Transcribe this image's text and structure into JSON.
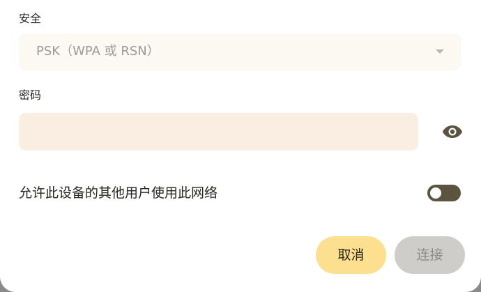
{
  "security": {
    "label": "安全",
    "selected_value": "PSK（WPA 或 RSN）",
    "icon": "chevron-down-icon"
  },
  "password": {
    "label": "密码",
    "value": "",
    "placeholder": "",
    "toggle_icon": "eye-icon"
  },
  "share": {
    "label": "允许此设备的其他用户使用此网络",
    "enabled": false
  },
  "actions": {
    "cancel_label": "取消",
    "connect_label": "连接"
  },
  "colors": {
    "accent": "#5c5440",
    "cancel_bg": "#fde08f",
    "disabled_bg": "#cfcdca",
    "input_bg": "#faede1"
  }
}
